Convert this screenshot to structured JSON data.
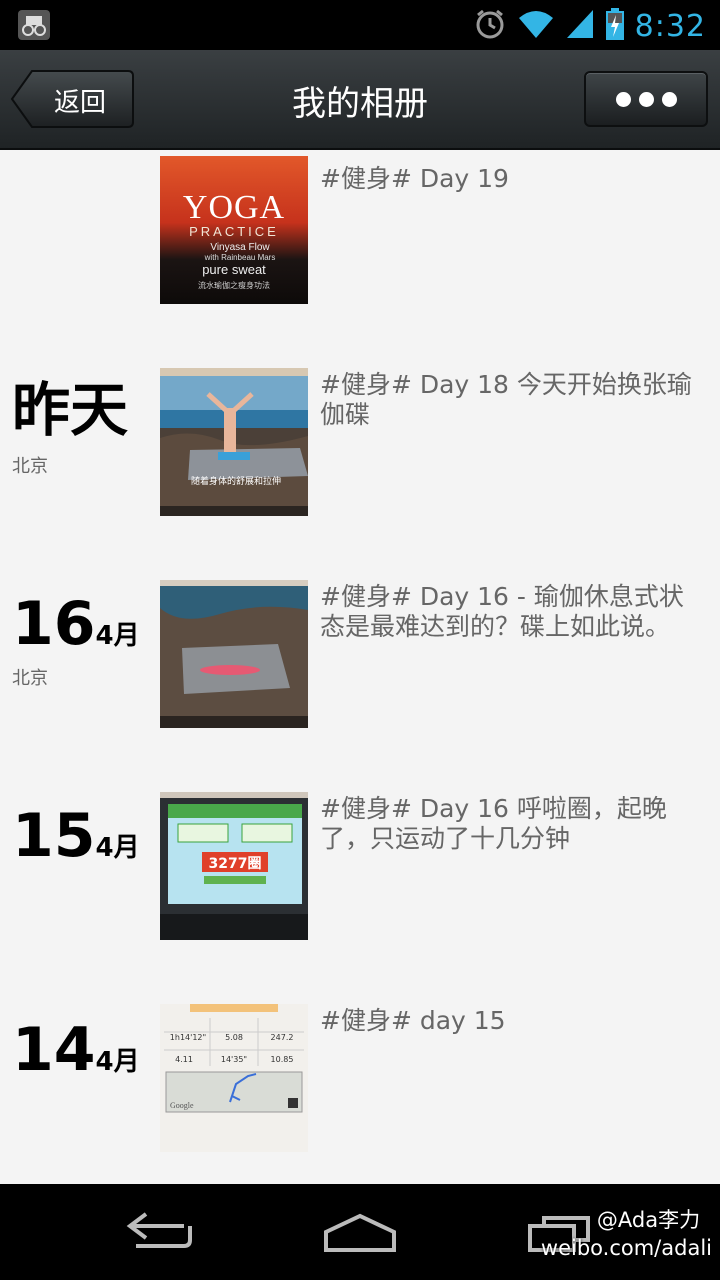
{
  "status_bar": {
    "time": "8:32"
  },
  "action_bar": {
    "back_label": "返回",
    "title": "我的相册"
  },
  "entries": [
    {
      "date_day": "",
      "date_month": "",
      "location": "",
      "caption": "#健身# Day 19"
    },
    {
      "date_day": "昨天",
      "date_month": "",
      "location": "北京",
      "caption": "#健身# Day 18  今天开始换张瑜伽碟"
    },
    {
      "date_day": "16",
      "date_month": "4月",
      "location": "北京",
      "caption": "#健身# Day 16 - 瑜伽休息式状态是最难达到的？碟上如此说。"
    },
    {
      "date_day": "15",
      "date_month": "4月",
      "location": "",
      "caption": "#健身# Day 16  呼啦圈，起晚了，只运动了十几分钟"
    },
    {
      "date_day": "14",
      "date_month": "4月",
      "location": "",
      "caption": "#健身# day 15"
    }
  ],
  "thumbs": {
    "yoga": {
      "line1": "YOGA",
      "line2": "PRACTICE",
      "line3": "Vinyasa Flow",
      "line4": "with Rainbeau Mars",
      "line5": "pure sweat",
      "line6": "流水瑜伽之瘦身功法"
    },
    "beach": {
      "subtitle": "随着身体的舒展和拉伸"
    },
    "hoop": {
      "score": "3277圈"
    },
    "run": {
      "cells": [
        "1h14'12\"",
        "5.08",
        "247.2",
        "4.11",
        "14'35\"",
        "10.85"
      ],
      "map_label": "Google"
    }
  },
  "watermark": {
    "line1": "@Ada李力",
    "line2": "weibo.com/adali"
  },
  "colors": {
    "time": "#33b5e5",
    "action_bar": "#2b3033",
    "background": "#f4f4f4"
  }
}
